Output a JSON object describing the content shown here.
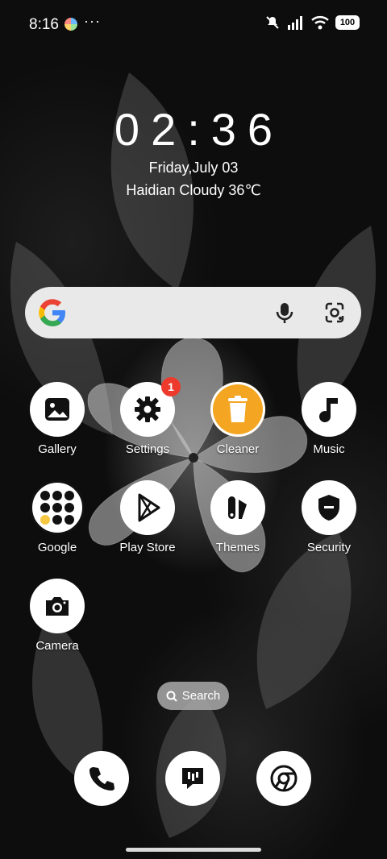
{
  "status_bar": {
    "time": "8:16",
    "more": "···",
    "battery": "100"
  },
  "clock": {
    "time": "02:36",
    "date": "Friday,July 03",
    "weather": "Haidian Cloudy 36℃"
  },
  "search_widget": {
    "mic_icon": "mic-icon",
    "lens_icon": "lens-icon"
  },
  "apps": [
    {
      "label": "Gallery",
      "icon": "gallery-icon"
    },
    {
      "label": "Settings",
      "icon": "gear-icon",
      "badge": "1"
    },
    {
      "label": "Cleaner",
      "icon": "trash-icon",
      "color": "#f4a623"
    },
    {
      "label": "Music",
      "icon": "music-note-icon"
    },
    {
      "label": "Google",
      "icon": "google-folder-icon"
    },
    {
      "label": "Play Store",
      "icon": "play-store-icon"
    },
    {
      "label": "Themes",
      "icon": "themes-icon"
    },
    {
      "label": "Security",
      "icon": "shield-icon"
    },
    {
      "label": "Camera",
      "icon": "camera-icon"
    }
  ],
  "search_pill": {
    "label": "Search"
  },
  "dock": [
    {
      "icon": "phone-icon"
    },
    {
      "icon": "messages-icon"
    },
    {
      "icon": "chrome-icon"
    }
  ]
}
